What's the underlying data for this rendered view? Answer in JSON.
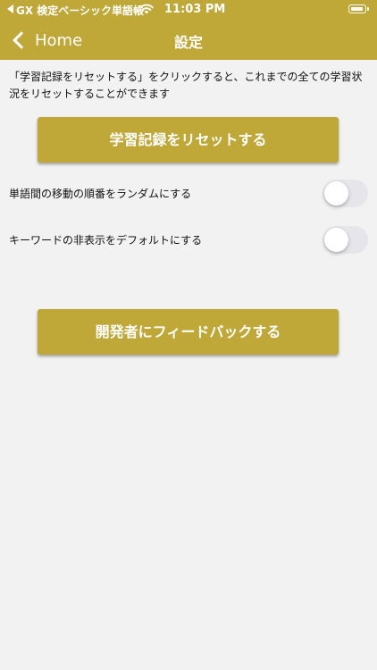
{
  "status_bar": {
    "app": "GX 検定ベーシック単語帳",
    "time": "11:03 PM"
  },
  "navbar": {
    "back_label": "Home",
    "title": "設定"
  },
  "description": "「学習記録をリセットする」をクリックすると、これまでの全ての学習状況をリセットすることができます",
  "reset_button": "学習記録をリセットする",
  "settings": [
    {
      "label": "単語間の移動の順番をランダムにする",
      "enabled": false
    },
    {
      "label": "キーワードの非表示をデフォルトにする",
      "enabled": false
    }
  ],
  "feedback_button": "開発者にフィードバックする",
  "colors": {
    "accent": "#bfa738",
    "background": "#f2f2f2",
    "toggle_off": "#e5e5ea"
  }
}
